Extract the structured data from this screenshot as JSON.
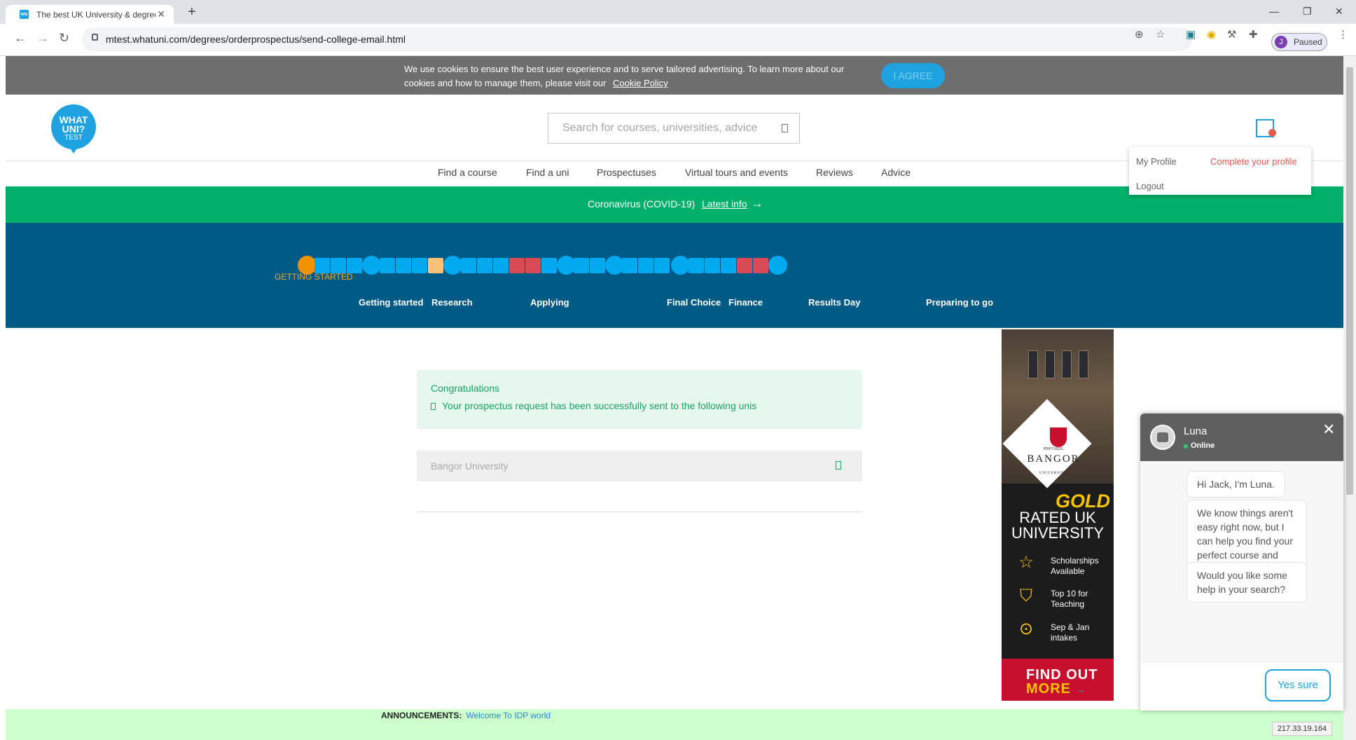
{
  "browser": {
    "tab_title": "The best UK University & degree",
    "url": "mtest.whatuni.com/degrees/orderprospectus/send-college-email.html",
    "profile_label": "Paused",
    "profile_initial": "J"
  },
  "cookie_banner": {
    "message": "We use cookies to ensure the best user experience and to serve tailored advertising. To learn more about our cookies and how to manage them, please visit our",
    "link": "Cookie Policy",
    "agree": "I AGREE"
  },
  "header": {
    "logo_line1": "WHAT",
    "logo_line2": "UNI?",
    "logo_line3": "TEST",
    "search_placeholder": "Search for courses, universities, advice"
  },
  "nav": [
    "Find a course",
    "Find a uni",
    "Prospectuses",
    "Virtual tours and events",
    "Reviews",
    "Advice"
  ],
  "profile_menu": {
    "my_profile": "My Profile",
    "complete": "Complete your profile",
    "logout": "Logout"
  },
  "covid": {
    "text": "Coronavirus (COVID-19)",
    "link": "Latest info"
  },
  "journey": {
    "current_stage": "GETTING STARTED",
    "stages": [
      "Getting started",
      "Research",
      "Applying",
      "Final Choice",
      "Finance",
      "Results Day",
      "Preparing to go"
    ],
    "colors": {
      "orange": "#f39200",
      "blue": "#00a9f0",
      "light": "#f8c27a",
      "red": "#d94a57"
    }
  },
  "confirmation": {
    "heading": "Congratulations",
    "message": "Your prospectus request has been successfully sent to the following unis",
    "universities": [
      "Bangor University"
    ]
  },
  "ad": {
    "welsh_name": "PRIFYSGOL",
    "name": "BANGOR",
    "sub": "UNIVERSITY",
    "gold": "GOLD",
    "rated_line1": "RATED UK",
    "rated_line2": "UNIVERSITY",
    "features": [
      {
        "line1": "Scholarships",
        "line2": "Available",
        "icon": "star-icon"
      },
      {
        "line1": "Top 10 for",
        "line2": "Teaching",
        "icon": "shield-check-icon"
      },
      {
        "line1": "Sep & Jan",
        "line2": "intakes",
        "icon": "location-pin-icon"
      }
    ],
    "cta_line1": "FIND OUT",
    "cta_line2": "MORE"
  },
  "announcements": {
    "label": "ANNOUNCEMENTS:",
    "text": "Welcome To IDP world"
  },
  "chat": {
    "name": "Luna",
    "status": "Online",
    "messages": [
      "Hi Jack, I'm Luna.",
      "We know things aren't easy right now, but I can help you find your perfect course and uni.",
      "Would you like some help in your search?"
    ],
    "reply": "Yes sure"
  },
  "ip_address": "217.33.19.164"
}
